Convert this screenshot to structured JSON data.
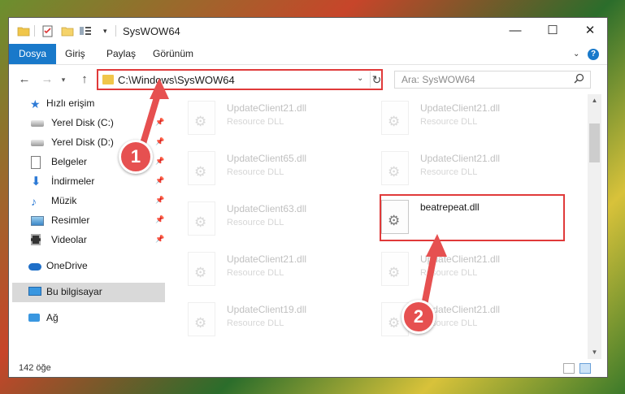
{
  "window": {
    "title": "SysWOW64",
    "controls": {
      "minimize": "—",
      "maximize": "☐",
      "close": "✕"
    }
  },
  "ribbon": {
    "tabs": [
      "Dosya",
      "Giriş",
      "Paylaş",
      "Görünüm"
    ],
    "help": "?"
  },
  "address": {
    "path": "C:\\Windows\\SysWOW64",
    "search_placeholder": "Ara: SysWOW64"
  },
  "sidebar": {
    "quick_access": "Hızlı erişim",
    "items": [
      {
        "label": "Yerel Disk (C:)",
        "icon": "disk-icon",
        "pinned": true
      },
      {
        "label": "Yerel Disk (D:)",
        "icon": "disk-icon",
        "pinned": true
      },
      {
        "label": "Belgeler",
        "icon": "documents-icon",
        "pinned": true
      },
      {
        "label": "İndirmeler",
        "icon": "downloads-icon",
        "pinned": true
      },
      {
        "label": "Müzik",
        "icon": "music-icon",
        "pinned": true
      },
      {
        "label": "Resimler",
        "icon": "pictures-icon",
        "pinned": true
      },
      {
        "label": "Videolar",
        "icon": "videos-icon",
        "pinned": true
      }
    ],
    "onedrive": "OneDrive",
    "this_pc": "Bu bilgisayar",
    "network": "Ağ"
  },
  "files": [
    {
      "name": "UpdateClient21.dll",
      "type": "Resource DLL",
      "faded": true
    },
    {
      "name": "UpdateClient21.dll",
      "type": "Resource DLL",
      "faded": true
    },
    {
      "name": "UpdateClient65.dll",
      "type": "Resource DLL",
      "faded": true
    },
    {
      "name": "UpdateClient21.dll",
      "type": "Resource DLL",
      "faded": true
    },
    {
      "name": "UpdateClient63.dll",
      "type": "Resource DLL",
      "faded": true
    },
    {
      "name": "beatrepeat.dll",
      "type": "",
      "faded": false
    },
    {
      "name": "UpdateClient21.dll",
      "type": "Resource DLL",
      "faded": true
    },
    {
      "name": "UpdateClient21.dll",
      "type": "Resource DLL",
      "faded": true
    },
    {
      "name": "UpdateClient19.dll",
      "type": "Resource DLL",
      "faded": true
    },
    {
      "name": "UpdateClient21.dll",
      "type": "Resource DLL",
      "faded": true
    }
  ],
  "status": {
    "item_count": "142 öğe"
  },
  "callouts": {
    "step1": "1",
    "step2": "2"
  },
  "colors": {
    "accent": "#1979ca",
    "highlight": "#e03a3a",
    "callout": "#e65050"
  }
}
